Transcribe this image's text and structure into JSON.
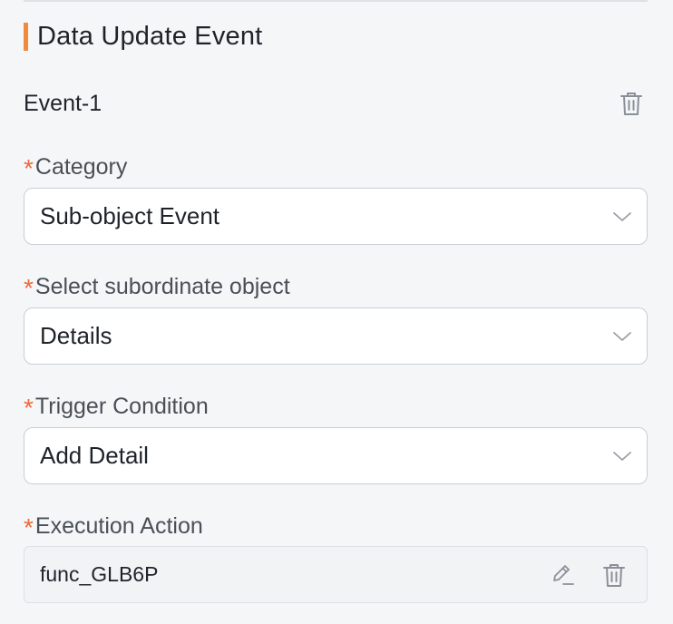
{
  "section": {
    "title": "Data Update Event"
  },
  "event": {
    "name": "Event-1"
  },
  "fields": [
    {
      "label": "Category",
      "required": "*",
      "value": "Sub-object Event"
    },
    {
      "label": "Select subordinate object",
      "required": "*",
      "value": "Details"
    },
    {
      "label": "Trigger Condition",
      "required": "*",
      "value": "Add Detail"
    },
    {
      "label": "Execution Action",
      "required": "*",
      "value": "func_GLB6P"
    }
  ],
  "colors": {
    "accent": "#f08a3c",
    "required": "#ee6a3d",
    "border": "#c9cdd4",
    "icon": "#8a9099"
  },
  "icons": [
    "trash-icon",
    "chevron-down-icon",
    "edit-icon"
  ]
}
